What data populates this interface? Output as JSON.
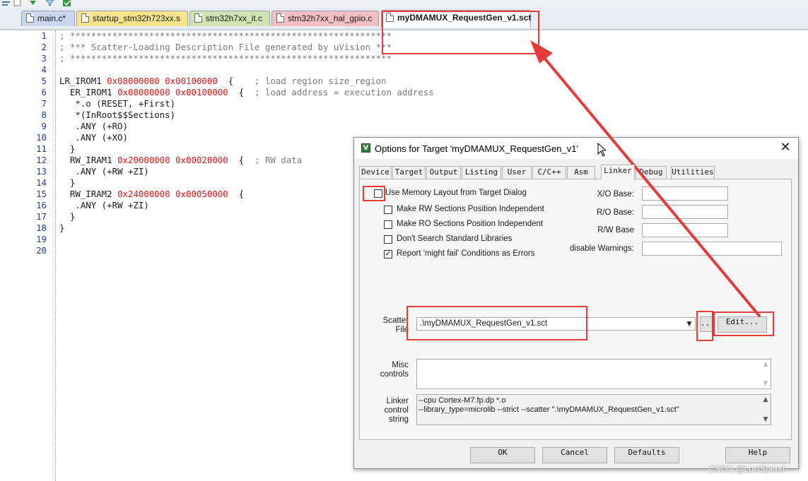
{
  "tabs": [
    {
      "label": "main.c*",
      "color": "#c9d6ee"
    },
    {
      "label": "startup_stm32h723xx.s",
      "color": "#f6e48a"
    },
    {
      "label": "stm32h7xx_it.c",
      "color": "#cfe3b3"
    },
    {
      "label": "stm32h7xx_hal_gpio.c",
      "color": "#f2c0c4"
    },
    {
      "label": "myDMAMUX_RequestGen_v1.sct",
      "color": "#ffffff"
    }
  ],
  "code_lines": [
    {
      "num": "1",
      "text": "; *************************************************************"
    },
    {
      "num": "2",
      "text": "; *** Scatter-Loading Description File generated by uVision ***"
    },
    {
      "num": "3",
      "text": "; *************************************************************"
    },
    {
      "num": "4",
      "text": ""
    },
    {
      "num": "5",
      "text": "LR_IROM1 0x08000000 0x00100000  {    ; load region size_region"
    },
    {
      "num": "6",
      "text": "  ER_IROM1 0x08000000 0x00100000  {  ; load address = execution address"
    },
    {
      "num": "7",
      "text": "   *.o (RESET, +First)"
    },
    {
      "num": "8",
      "text": "   *(InRoot$$Sections)"
    },
    {
      "num": "9",
      "text": "   .ANY (+RO)"
    },
    {
      "num": "10",
      "text": "   .ANY (+XO)"
    },
    {
      "num": "11",
      "text": "  }"
    },
    {
      "num": "12",
      "text": "  RW_IRAM1 0x20000000 0x00020000  {  ; RW data"
    },
    {
      "num": "13",
      "text": "   .ANY (+RW +ZI)"
    },
    {
      "num": "14",
      "text": "  }"
    },
    {
      "num": "15",
      "text": "  RW_IRAM2 0x24000000 0x00050000  {"
    },
    {
      "num": "16",
      "text": "   .ANY (+RW +ZI)"
    },
    {
      "num": "17",
      "text": "  }"
    },
    {
      "num": "18",
      "text": "}"
    },
    {
      "num": "19",
      "text": ""
    },
    {
      "num": "20",
      "text": ""
    }
  ],
  "dialog": {
    "title": "Options for Target 'myDMAMUX_RequestGen_v1'",
    "close_glyph": "✕",
    "tabs": [
      "Device",
      "Target",
      "Output",
      "Listing",
      "User",
      "C/C++",
      "Asm",
      "Linker",
      "Debug",
      "Utilities"
    ],
    "active_tab": "Linker",
    "checkboxes": [
      {
        "label": "Use Memory Layout from Target Dialog",
        "checked": false
      },
      {
        "label": "Make RW Sections Position Independent",
        "checked": false
      },
      {
        "label": "Make RO Sections Position Independent",
        "checked": false
      },
      {
        "label": "Don't Search Standard Libraries",
        "checked": false
      },
      {
        "label": "Report 'might fail' Conditions as Errors",
        "checked": true
      }
    ],
    "check_glyph": "✓",
    "fields": {
      "xo_base": {
        "label": "X/O Base:",
        "value": ""
      },
      "ro_base": {
        "label": "R/O Base:",
        "value": ""
      },
      "rw_base": {
        "label": "R/W Base",
        "value": ""
      },
      "disable_warnings": {
        "label": "disable Warnings:",
        "value": ""
      }
    },
    "scatter": {
      "label_line1": "Scatter",
      "label_line2": "File",
      "value": ".\\myDMAMUX_RequestGen_v1.sct",
      "browse_label": "...",
      "edit_label": "Edit..."
    },
    "misc": {
      "label_line1": "Misc",
      "label_line2": "controls",
      "value": ""
    },
    "linker_control": {
      "label_line1": "Linker",
      "label_line2": "control",
      "label_line3": "string",
      "line1": "--cpu Cortex-M7.fp.dp *.o",
      "line2": "--library_type=microlib --strict --scatter \".\\myDMAMUX_RequestGen_v1.sct\""
    },
    "buttons": {
      "ok": "OK",
      "cancel": "Cancel",
      "defaults": "Defaults",
      "help": "Help"
    }
  },
  "annotation_color": "#e63b3b",
  "watermark": "CSDN @LostSpeed"
}
